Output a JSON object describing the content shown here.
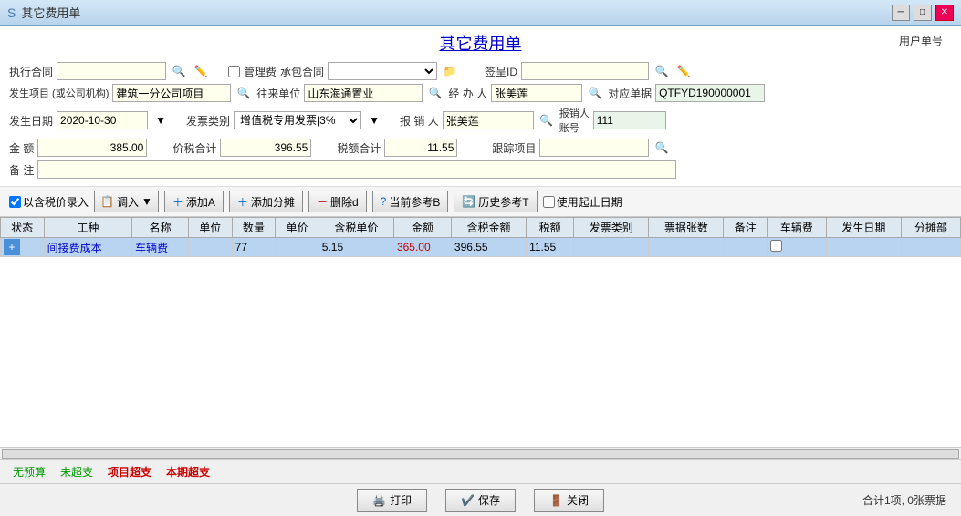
{
  "titleBar": {
    "icon": "S",
    "text": "其它费用单",
    "minBtn": "─",
    "maxBtn": "□",
    "closeBtn": "✕"
  },
  "pageTitle": "其它费用单",
  "userInfo": "用户单号",
  "form": {
    "row1": {
      "execContractLabel": "执行合同",
      "execContractValue": "",
      "manageFeeLabel": "管理费",
      "attachContractLabel": "承包合同",
      "attachContractValue": "",
      "signLabel": "签呈ID",
      "signValue": ""
    },
    "row2": {
      "projectLabel": "发生项目\n(或公司机构)",
      "projectValue": "建筑一分公司项目",
      "toUnitLabel": "往来单位",
      "toUnitValue": "山东海通置业",
      "bizPersonLabel": "经 办 人",
      "bizPersonValue": "张美莲",
      "correspondLabel": "对应单据",
      "correspondValue": "QTFYD190000001"
    },
    "row3": {
      "dateLabel": "发生日期",
      "dateValue": "2020-10-30",
      "invoiceTypeLabel": "发票类别",
      "invoiceTypeValue": "增值税专用发票|3%",
      "reporterLabel": "报 销 人",
      "reporterValue": "张美莲",
      "reportNumLabel": "报销人\n账号",
      "reportNumValue": "111"
    },
    "row4": {
      "amountLabel": "金 额",
      "amountValue": "385.00",
      "taxIncAmountLabel": "价税合计",
      "taxIncAmountValue": "396.55",
      "taxAmountLabel": "税额合计",
      "taxAmountValue": "11.55",
      "trackProjectLabel": "跟踪项目",
      "trackProjectValue": ""
    },
    "row5": {
      "remarkLabel": "备 注",
      "remarkValue": ""
    }
  },
  "toolbar": {
    "taxIncludeLabel": "以含税价录入",
    "adjustBtn": "调入",
    "addBtn": "添加A",
    "addSplitBtn": "添加分摊",
    "deleteBtn": "删除d",
    "currentRefBtn": "当前参考B",
    "historyRefBtn": "历史参考T",
    "useDateLabel": "使用起止日期"
  },
  "table": {
    "headers": [
      "状态",
      "工种",
      "名称",
      "单位",
      "数量",
      "单价",
      "含税单价",
      "金额",
      "含税金额",
      "税额",
      "发票类别",
      "票据张数",
      "备注",
      "车辆费",
      "发生日期",
      "分摊部"
    ],
    "rows": [
      {
        "status": "+",
        "workType": "间接费成本",
        "name": "车辆费",
        "unit": "",
        "qty": "77",
        "price": "",
        "taxPrice": "5.15",
        "amount": "365.00",
        "taxAmount": "396.55",
        "taxVal": "11.55",
        "invoiceType": "",
        "invoiceCount": "",
        "remark": "",
        "vehicleFee": "",
        "date": "",
        "split": ""
      }
    ]
  },
  "statusBar": {
    "nobudget": "无预算",
    "notover": "未超支",
    "projectover": "项目超支",
    "monthover": "本期超支"
  },
  "bottomBar": {
    "printBtn": "打印",
    "saveBtn": "保存",
    "closeBtn": "关闭",
    "totalInfo": "合计1项, 0张票据"
  }
}
